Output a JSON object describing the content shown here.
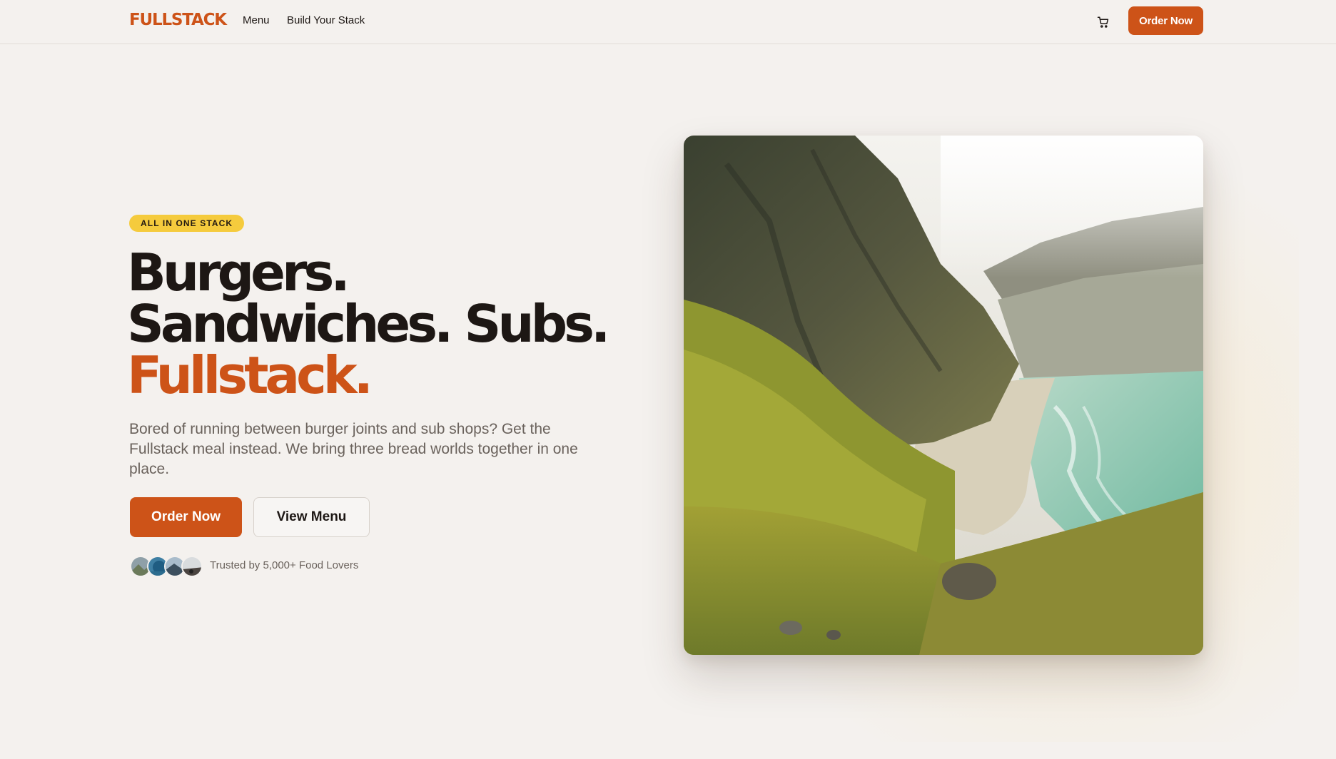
{
  "brand": {
    "logo_text": "FULLSTACK",
    "accent_color": "#cd5318",
    "badge_color": "#f5cb3d"
  },
  "nav": {
    "links": [
      {
        "label": "Menu"
      },
      {
        "label": "Build Your Stack"
      }
    ],
    "cart_icon": "cart-icon",
    "cta_label": "Order Now"
  },
  "hero": {
    "badge": "ALL IN ONE STACK",
    "headline": {
      "line1": "Burgers.",
      "line2": "Sandwiches. Subs.",
      "line3": "Fullstack."
    },
    "subtext": "Bored of running between burger joints and sub shops? Get the Fullstack meal instead. We bring three bread worlds together in one place.",
    "primary_button": "Order Now",
    "secondary_button": "View Menu",
    "trust_text": "Trusted by 5,000+ Food Lovers",
    "avatar_count": 4,
    "image_subject": "green mountain valley with sandy beach and turquoise sea"
  }
}
